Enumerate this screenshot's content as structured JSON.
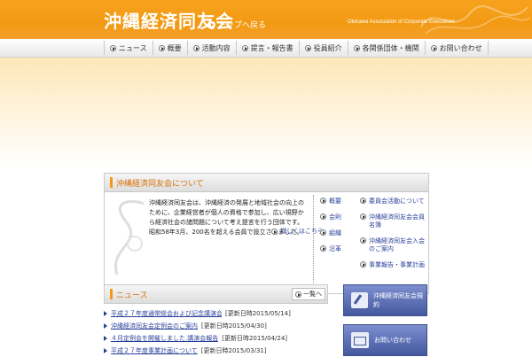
{
  "header": {
    "title": "沖縄経済同友会",
    "back_to_top": "トップへ戻る",
    "tagline": "Okinawa Association of Corporate Executives"
  },
  "nav": [
    {
      "label": "ニュース"
    },
    {
      "label": "概要"
    },
    {
      "label": "活動内容"
    },
    {
      "label": "提言・報告書"
    },
    {
      "label": "役員紹介"
    },
    {
      "label": "各関係団体・機関"
    },
    {
      "label": "お問い合わせ"
    }
  ],
  "about": {
    "heading": "沖縄経済同友会について",
    "text": "沖縄経済同友会は、沖縄経済の発展と地域社会の向上のために、企業経営者が個人の資格で参加し、広い視野から経済社会の諸問題について考え提言を行う団体です。昭和58年3月、200名を超える会員で設立されました。",
    "more": "詳しくはこちら",
    "links_col1": [
      "概要",
      "会則",
      "組織",
      "沿革"
    ],
    "links_col2": [
      "委員会活動について",
      "沖縄経済同友会会員名簿",
      "沖縄経済同友会入会のご案内",
      "事業報告・事業計画"
    ]
  },
  "news": {
    "heading": "ニュース",
    "more": "一覧へ",
    "items": [
      {
        "title": "平成２７年度通常総会および記念講演会を開催しました…",
        "date": "[更新日時2015/05/14]"
      },
      {
        "title": "沖縄経済同友会定例会のご案内",
        "date": "[更新日時2015/04/30]"
      },
      {
        "title": "４月定例会を開催しました.講演会報告",
        "date": "[更新日時2015/04/24]"
      },
      {
        "title": "平成２７年度事業計画について",
        "date": "[更新日時2015/03/31]"
      }
    ]
  },
  "side": {
    "rules_btn": "沖縄経済同友会規約",
    "contact_btn": "お問い合わせ"
  }
}
